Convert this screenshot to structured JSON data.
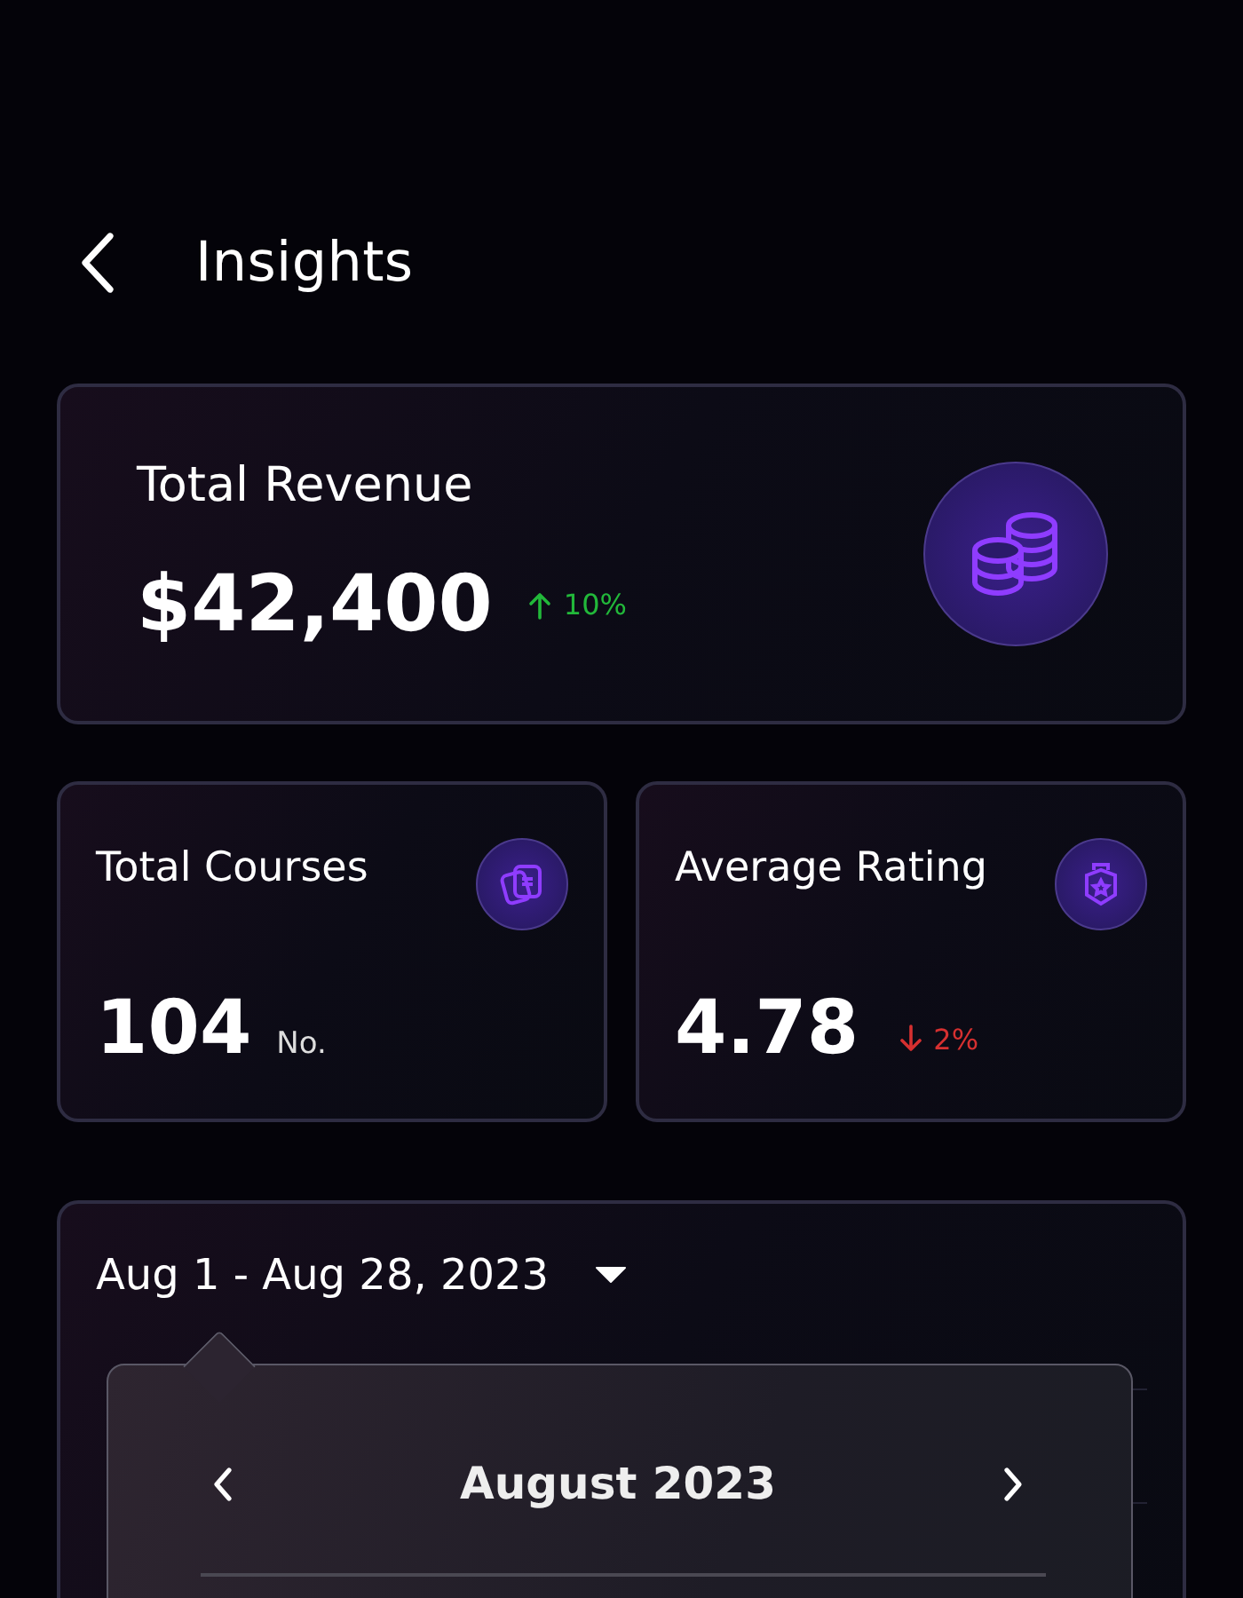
{
  "header": {
    "title": "Insights"
  },
  "revenue": {
    "label": "Total Revenue",
    "value": "$42,400",
    "trend": {
      "kind": "up",
      "text": "10%"
    }
  },
  "stats": [
    {
      "kind": "courses",
      "label": "Total Courses",
      "value": "104",
      "unit": "No."
    },
    {
      "kind": "rating",
      "label": "Average Rating",
      "value": "4.78",
      "trend": {
        "kind": "down",
        "text": "2%"
      }
    }
  ],
  "chart_panel": {
    "range": "Aug 1 - Aug 28, 2023"
  },
  "calendar": {
    "month": "August 2023"
  }
}
